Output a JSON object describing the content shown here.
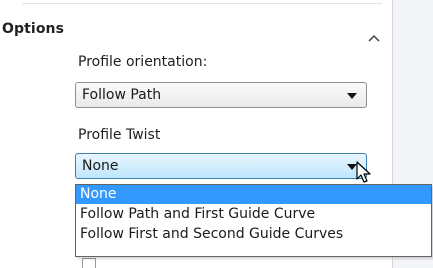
{
  "section": {
    "title": "Options"
  },
  "profile_orientation": {
    "label": "Profile orientation:",
    "selected": "Follow Path"
  },
  "profile_twist": {
    "label": "Profile Twist",
    "selected": "None",
    "options": [
      "None",
      "Follow Path and First Guide Curve",
      "Follow First and Second Guide Curves"
    ],
    "highlighted_option": "None"
  },
  "colors": {
    "highlight": "#3399ff",
    "active_select_border": "#3c7fb1"
  },
  "icons": {
    "collapse": "chevron-up-icon",
    "dropdown_arrow": "caret-down-icon",
    "cursor": "mouse-pointer-icon"
  }
}
